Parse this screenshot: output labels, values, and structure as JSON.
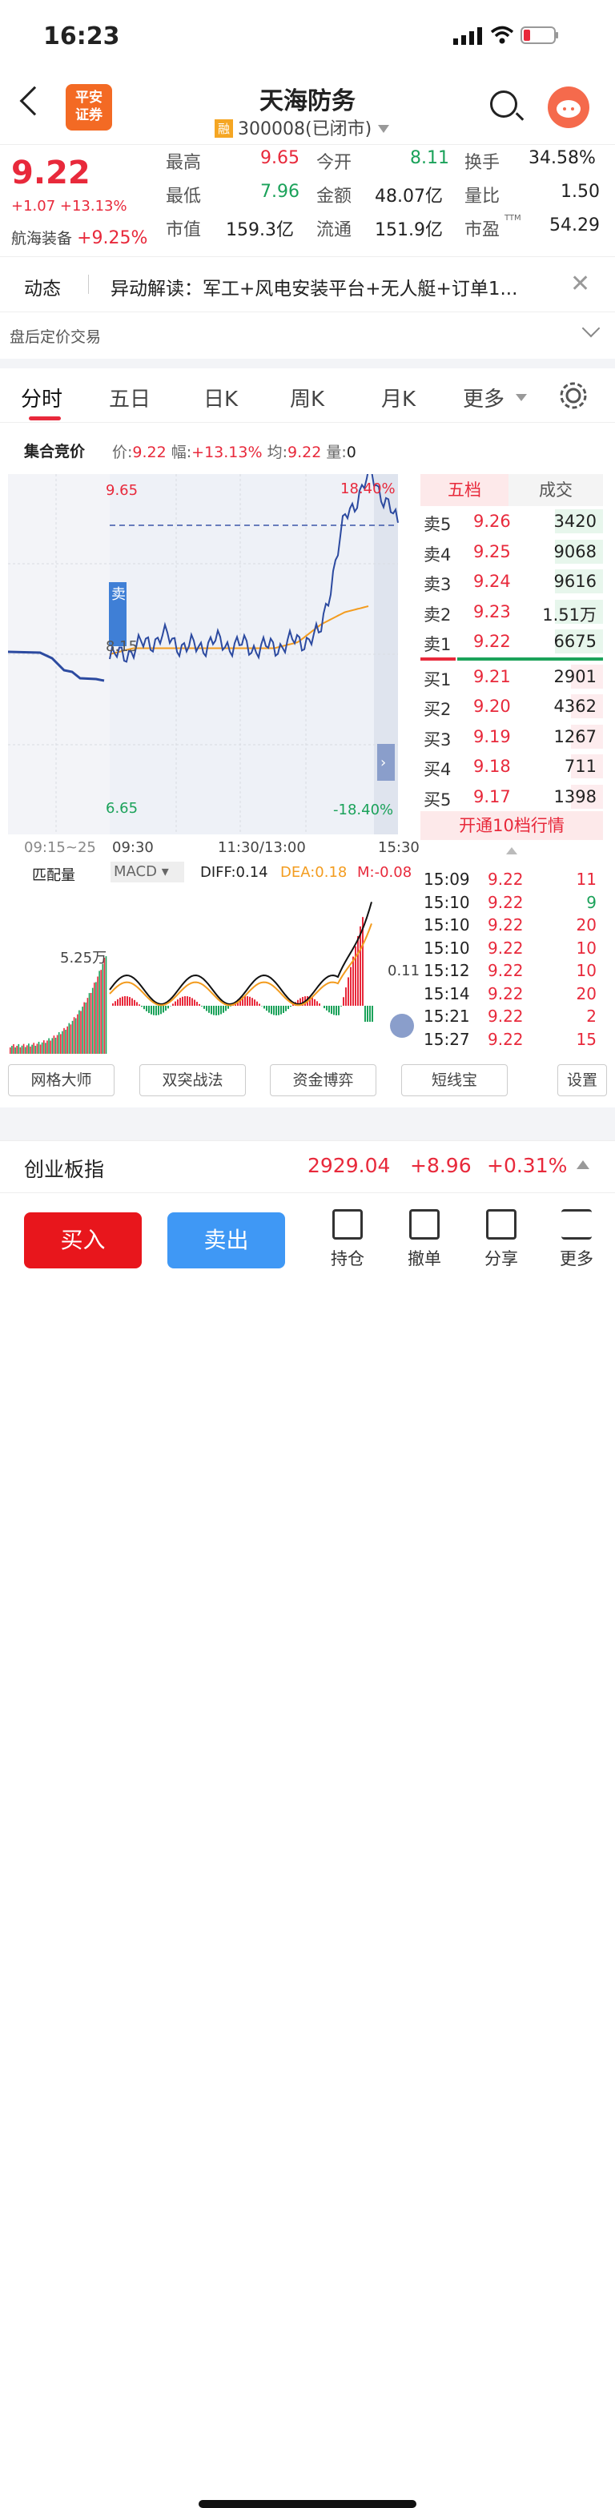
{
  "status": {
    "time": "16:23"
  },
  "header": {
    "logo_line1": "平安",
    "logo_line2": "证券",
    "name": "天海防务",
    "rong": "融",
    "code": "300008(已闭市)"
  },
  "quote": {
    "price": "9.22",
    "change": "+1.07 +13.13%",
    "sector": "航海装备",
    "sector_change": "+9.25%",
    "cells": [
      {
        "label": "最高",
        "value": "9.65",
        "color": "red"
      },
      {
        "label": "今开",
        "value": "8.11",
        "color": "green"
      },
      {
        "label": "换手",
        "value": "34.58%",
        "color": "black"
      },
      {
        "label": "最低",
        "value": "7.96",
        "color": "green"
      },
      {
        "label": "金额",
        "value": "48.07亿",
        "color": "black"
      },
      {
        "label": "量比",
        "value": "1.50",
        "color": "black"
      },
      {
        "label": "市值",
        "value": "159.3亿",
        "color": "black"
      },
      {
        "label": "流通",
        "value": "151.9亿",
        "color": "black"
      },
      {
        "label": "市盈",
        "value": "54.29",
        "color": "black"
      }
    ],
    "ttm": "TTM"
  },
  "dynamic": {
    "label": "动态",
    "text": "异动解读：军工+风电安装平台+无人艇+订单1..."
  },
  "after_hours": "盘后定价交易",
  "tabs": [
    "分时",
    "五日",
    "日K",
    "周K",
    "月K",
    "更多"
  ],
  "auction": {
    "title": "集合竞价",
    "price_label": "价:",
    "price": "9.22",
    "amp_label": "幅:",
    "amp": "+13.13%",
    "avg_label": "均:",
    "avg": "9.22",
    "vol_label": "量:",
    "vol": "0"
  },
  "chart": {
    "high": "9.65",
    "low": "6.65",
    "pct_high": "18.40%",
    "pct_low": "-18.40%",
    "mid_label": "8.15",
    "time_labels": [
      "09:15~25",
      "09:30",
      "11:30/13:00",
      "15:30"
    ],
    "sell_tag": "卖",
    "vol_tab": "匹配量",
    "macd_tab": "MACD",
    "diff": "DIFF:0.14",
    "dea": "DEA:0.18",
    "m": "M:-0.08",
    "vol_label": "5.25万",
    "macd_value": "0.11"
  },
  "orderbook": {
    "tab1": "五档",
    "tab2": "成交",
    "asks": [
      {
        "label": "卖5",
        "price": "9.26",
        "vol": "3420"
      },
      {
        "label": "卖4",
        "price": "9.25",
        "vol": "9068"
      },
      {
        "label": "卖3",
        "price": "9.24",
        "vol": "9616"
      },
      {
        "label": "卖2",
        "price": "9.23",
        "vol": "1.51万"
      },
      {
        "label": "卖1",
        "price": "9.22",
        "vol": "6675"
      }
    ],
    "bids": [
      {
        "label": "买1",
        "price": "9.21",
        "vol": "2901"
      },
      {
        "label": "买2",
        "price": "9.20",
        "vol": "4362"
      },
      {
        "label": "买3",
        "price": "9.19",
        "vol": "1267"
      },
      {
        "label": "买4",
        "price": "9.18",
        "vol": "711"
      },
      {
        "label": "买5",
        "price": "9.17",
        "vol": "1398"
      }
    ],
    "open10": "开通10档行情"
  },
  "trades": [
    {
      "time": "15:09",
      "price": "9.22",
      "vol": "11"
    },
    {
      "time": "15:10",
      "price": "9.22",
      "vol": "9"
    },
    {
      "time": "15:10",
      "price": "9.22",
      "vol": "20"
    },
    {
      "time": "15:10",
      "price": "9.22",
      "vol": "10"
    },
    {
      "time": "15:12",
      "price": "9.22",
      "vol": "10"
    },
    {
      "time": "15:14",
      "price": "9.22",
      "vol": "20"
    },
    {
      "time": "15:21",
      "price": "9.22",
      "vol": "2"
    },
    {
      "time": "15:27",
      "price": "9.22",
      "vol": "15"
    }
  ],
  "tools": [
    "网格大师",
    "双突战法",
    "资金博弈",
    "短线宝",
    "设置"
  ],
  "index": {
    "name": "创业板指",
    "value": "2929.04",
    "change": "+8.96",
    "pct": "+0.31%"
  },
  "actions": {
    "buy": "买入",
    "sell": "卖出",
    "hold": "持仓",
    "cancel": "撤单",
    "share": "分享",
    "more": "更多"
  },
  "chart_data": {
    "type": "line",
    "title": "",
    "x": [
      "09:30",
      "11:30/13:00",
      "15:30"
    ],
    "ylim": [
      6.65,
      9.65
    ],
    "series": [
      {
        "values": [
          8.11,
          8.2,
          8.3,
          8.2,
          8.25,
          8.22,
          8.2,
          8.25,
          8.3,
          9.3,
          9.65,
          9.22
        ]
      },
      {
        "values": [
          8.15,
          8.2,
          8.2,
          8.2,
          8.2,
          8.2,
          8.2,
          8.2,
          8.25,
          8.4,
          8.5,
          8.55
        ]
      }
    ]
  }
}
